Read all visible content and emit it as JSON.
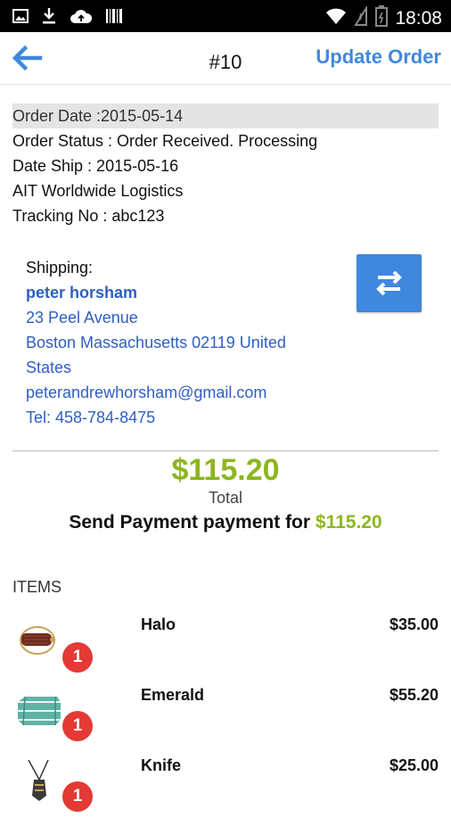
{
  "status_bar": {
    "time": "18:08",
    "left_icons": [
      "image-icon",
      "download-icon",
      "cloud-upload-icon",
      "barcode-icon"
    ],
    "right_icons": [
      "wifi-icon",
      "signal-icon",
      "battery-icon"
    ]
  },
  "app_bar": {
    "back_icon": "arrow-left-icon",
    "title": "#10",
    "action_label": "Update Order",
    "accent_color": "#3f88de"
  },
  "order_info": {
    "order_date": "Order Date :2015-05-14",
    "order_status": "Order Status : Order Received. Processing",
    "date_ship": "Date Ship : 2015-05-16",
    "carrier": "AIT Worldwide Logistics",
    "tracking": "Tracking No : abc123"
  },
  "shipping": {
    "label": "Shipping:",
    "name": "peter horsham",
    "address_line1": "23 Peel Avenue",
    "address_line2": "Boston Massachusetts 02119 United",
    "address_line3": "States",
    "email": "peterandrewhorsham@gmail.com",
    "phone": "Tel: 458-784-8475",
    "swap_icon": "swap-arrows-icon"
  },
  "total": {
    "amount": "$115.20",
    "label": "Total",
    "send_payment_text": "Send Payment payment for",
    "send_payment_amount": "$115.20",
    "amount_color": "#8cb61f"
  },
  "items_section": {
    "header": "ITEMS",
    "items": [
      {
        "name": "Halo",
        "price": "$35.00",
        "qty": "1",
        "icon": "bracelet-icon"
      },
      {
        "name": "Emerald",
        "price": "$55.20",
        "qty": "1",
        "icon": "gem-icon"
      },
      {
        "name": "Knife",
        "price": "$25.00",
        "qty": "1",
        "icon": "necklace-icon"
      }
    ],
    "badge_color": "#e53935"
  }
}
